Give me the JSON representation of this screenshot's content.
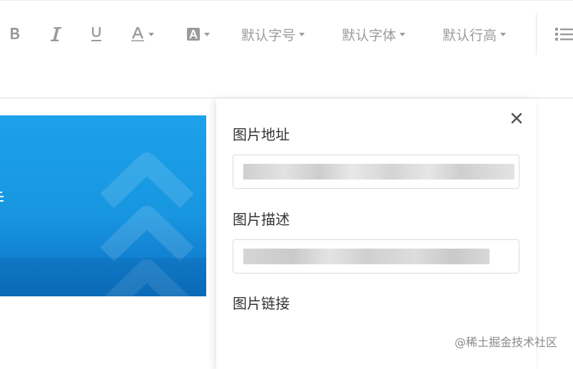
{
  "toolbar": {
    "bold_icon": "bold-icon",
    "italic_icon": "italic-icon",
    "underline_icon": "underline-icon",
    "font_color_icon": "font-color-icon",
    "bg_color_icon": "background-color-icon",
    "font_size_label": "默认字号",
    "font_family_label": "默认字体",
    "line_height_label": "默认行高",
    "list_icon": "unordered-list-icon"
  },
  "popup": {
    "url_label": "图片地址",
    "desc_label": "图片描述",
    "link_label": "图片链接",
    "close_icon": "close-icon"
  },
  "colors": {
    "banner_blue": "#1896e0",
    "icon_gray": "#9b9b9b"
  },
  "watermark": "@稀土掘金技术社区"
}
